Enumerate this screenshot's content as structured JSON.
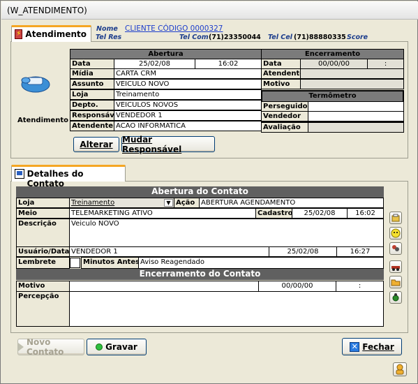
{
  "window": {
    "title": "(W_ATENDIMENTO)"
  },
  "tab1": {
    "label": "Atendimento"
  },
  "header": {
    "nome_label": "Nome",
    "nome_value": "CLIENTE CÓDIGO 0000327",
    "telres_label": "Tel Res",
    "telcom_label": "Tel Com",
    "telcom_value": "(71)23350044",
    "telcel_label": "Tel Cel",
    "telcel_value": "(71)88880335",
    "score_label": "Score"
  },
  "left": {
    "caption": "Atendimento"
  },
  "abertura": {
    "title": "Abertura",
    "data_label": "Data",
    "data_value": "25/02/08",
    "hora_value": "16:02",
    "midia_label": "Mídia",
    "midia_value": "CARTA CRM",
    "assunto_label": "Assunto",
    "assunto_value": "VEICULO NOVO",
    "loja_label": "Loja",
    "loja_value": "Treinamento",
    "depto_label": "Depto.",
    "depto_value": "VEICULOS NOVOS",
    "resp_label": "Responsável",
    "resp_value": "VENDEDOR 1",
    "atend_label": "Atendente",
    "atend_value": "ACAO INFORMATICA"
  },
  "encerramento": {
    "title": "Encerramento",
    "data_label": "Data",
    "data_value": "00/00/00",
    "hora_value": ":",
    "atend_label": "Atendente",
    "motivo_label": "Motivo",
    "termo_title": "Termômetro",
    "persegu_label": "Perseguidor",
    "vendedor_label": "Vendedor",
    "avaliacao_label": "Avaliação"
  },
  "buttons": {
    "alterar": "Alterar",
    "mudar": "Mudar Responsável",
    "novo": "Novo Contato",
    "gravar": "Gravar",
    "fechar": "Fechar"
  },
  "tab2": {
    "label": "Detalhes do Contato"
  },
  "contato": {
    "title": "Abertura do Contato",
    "loja_label": "Loja",
    "loja_value": "Treinamento",
    "acao_label": "Ação",
    "acao_value": "ABERTURA AGENDAMENTO",
    "meio_label": "Meio",
    "meio_value": "TELEMARKETING ATIVO",
    "cadastro_label": "Cadastro",
    "cadastro_date": "25/02/08",
    "cadastro_time": "16:02",
    "descricao_label": "Descrição",
    "descricao_value": "Veiculo NOVO",
    "usuario_label": "Usuário/Data",
    "usuario_value": "VENDEDOR 1",
    "usuario_date": "25/02/08",
    "usuario_time": "16:27",
    "lembrete_label": "Lembrete",
    "minutos_label": "Minutos Antes",
    "minutos_value": "Aviso Reagendado"
  },
  "encContato": {
    "title": "Encerramento do Contato",
    "motivo_label": "Motivo",
    "data_value": "00/00/00",
    "hora_value": ":",
    "percepcao_label": "Percepção"
  }
}
